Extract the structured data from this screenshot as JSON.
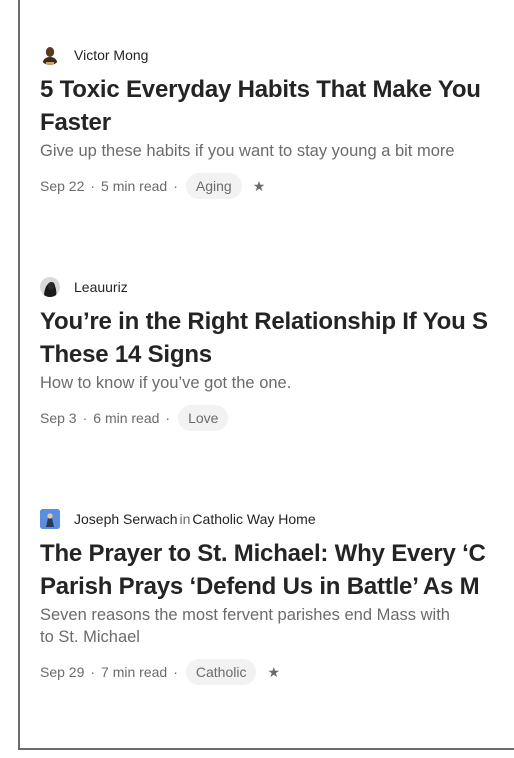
{
  "articles": [
    {
      "author": "Victor Mong",
      "publication_prefix": "",
      "publication": "",
      "title_line1": "5 Toxic Everyday Habits That Make You",
      "title_line2": "Faster",
      "subtitle": "Give up these habits if you want to stay young a bit more",
      "date": "Sep 22",
      "read_time": "5 min read",
      "tag": "Aging",
      "starred": "★",
      "avatar_icon": "person-avatar-icon"
    },
    {
      "author": "Leauuriz",
      "publication_prefix": "",
      "publication": "",
      "title_line1": "You’re in the Right Relationship If You S",
      "title_line2": "These 14 Signs",
      "subtitle": "How to know if you’ve got the one.",
      "date": "Sep 3",
      "read_time": "6 min read",
      "tag": "Love",
      "starred": "",
      "avatar_icon": "person-avatar-icon"
    },
    {
      "author": "Joseph Serwach",
      "publication_prefix": "in",
      "publication": "Catholic Way Home",
      "title_line1": "The Prayer to St. Michael: Why Every ‘C",
      "title_line2": "Parish Prays ‘Defend Us in Battle’ As M",
      "subtitle_line1": "Seven reasons the most fervent parishes end Mass with",
      "subtitle_line2": "to St. Michael",
      "date": "Sep 29",
      "read_time": "7 min read",
      "tag": "Catholic",
      "starred": "★",
      "avatar_icon": "person-avatar-icon"
    }
  ],
  "separator": "·"
}
